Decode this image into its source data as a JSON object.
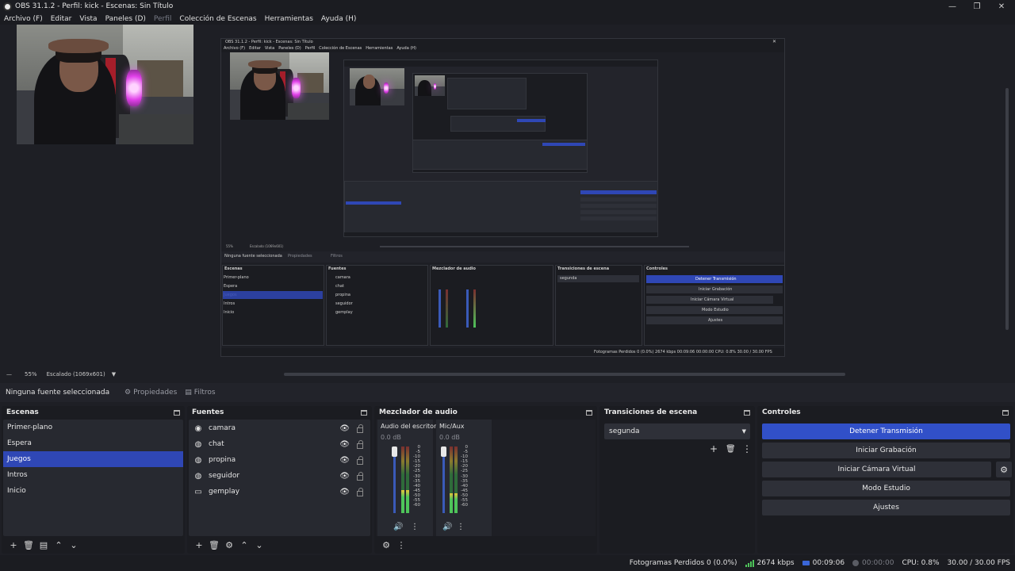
{
  "window": {
    "title": "OBS 31.1.2 - Perfil: kick - Escenas: Sin Título",
    "controls": [
      "—",
      "❐",
      "✕"
    ]
  },
  "menu": [
    "Archivo (F)",
    "Editar",
    "Vista",
    "Paneles (D)",
    "Perfil",
    "Colección de Escenas",
    "Herramientas",
    "Ayuda (H)"
  ],
  "preview": {
    "zoom": "55%",
    "scale_label": "Escalado (1069x601)",
    "nested_title": "OBS 31.1.2 - Perfil: kick - Escenas: Sin Título",
    "nested_menu": [
      "Archivo (F)",
      "Editar",
      "Vista",
      "Paneles (D)",
      "Perfil",
      "Colección de Escenas",
      "Herramientas",
      "Ayuda (H)"
    ],
    "nested_no_source": "Ninguna fuente seleccionada",
    "nested_props": "Propiedades",
    "nested_filters": "Filtros",
    "nested_docks": [
      "Escenas",
      "Fuentes",
      "Mezclador de audio",
      "Transiciones de escena",
      "Controles"
    ],
    "nested_status": "Fotogramas Perdidos 0 (0.0%)   2674 kbps   00:09:06   00:00:00   CPU: 0.8%   30.00 / 30.00 FPS"
  },
  "context": {
    "no_source": "Ninguna fuente seleccionada",
    "properties": "Propiedades",
    "filters": "Filtros"
  },
  "docks": {
    "scenes": {
      "title": "Escenas",
      "items": [
        "Primer-plano",
        "Espera",
        "Juegos",
        "Intros",
        "Inicio"
      ],
      "selected_index": 2
    },
    "sources": {
      "title": "Fuentes",
      "items": [
        {
          "name": "camara",
          "icon": "camera-icon"
        },
        {
          "name": "chat",
          "icon": "browser-icon"
        },
        {
          "name": "propina",
          "icon": "browser-icon"
        },
        {
          "name": "seguidor",
          "icon": "browser-icon"
        },
        {
          "name": "gemplay",
          "icon": "monitor-icon"
        }
      ]
    },
    "mixer": {
      "title": "Mezclador de audio",
      "channels": [
        {
          "name": "Audio del escritorio",
          "db": "0.0 dB",
          "level": 0.35
        },
        {
          "name": "Mic/Aux",
          "db": "0.0 dB",
          "level": 0.3
        }
      ],
      "scale": [
        "0",
        "-5",
        "-10",
        "-15",
        "-20",
        "-25",
        "-30",
        "-35",
        "-40",
        "-45",
        "-50",
        "-55",
        "-60"
      ]
    },
    "transitions": {
      "title": "Transiciones de escena",
      "selected": "segunda"
    },
    "controls": {
      "title": "Controles",
      "buttons": [
        "Detener Transmisión",
        "Iniciar Grabación",
        "Iniciar Cámara Virtual",
        "Modo Estudio",
        "Ajustes"
      ]
    }
  },
  "status": {
    "dropped": "Fotogramas Perdidos 0 (0.0%)",
    "bitrate": "2674 kbps",
    "stream_time": "00:09:06",
    "rec_time": "00:00:00",
    "cpu": "CPU: 0.8%",
    "fps": "30.00 / 30.00 FPS"
  },
  "colors": {
    "accent": "#3150c8",
    "selection": "#2f47b5",
    "background": "#1e1f25",
    "panel": "#272930"
  }
}
